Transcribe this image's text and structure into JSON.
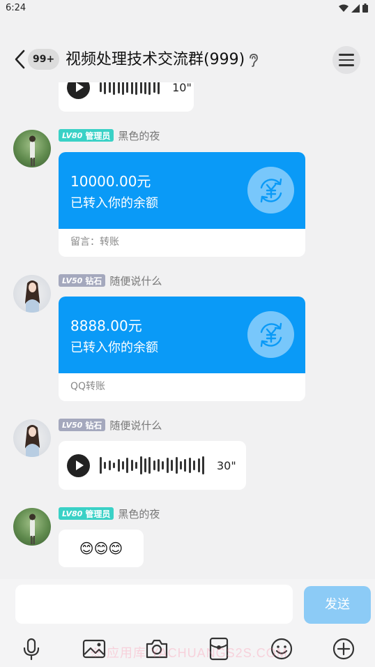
{
  "status_bar": {
    "time": "6:24"
  },
  "header": {
    "unread_badge": "99+",
    "title": "视频处理技术交流群(999)"
  },
  "messages": [
    {
      "kind": "voice",
      "duration": "10\""
    },
    {
      "kind": "transfer",
      "level": "LV80",
      "role": "管理员",
      "nickname": "黑色的夜",
      "amount": "10000.00元",
      "subtitle": "已转入你的余额",
      "note": "留言：转账"
    },
    {
      "kind": "transfer",
      "level": "LV50",
      "role": "钻石",
      "nickname": "随便说什么",
      "amount": "8888.00元",
      "subtitle": "已转入你的余额",
      "note": "QQ转账"
    },
    {
      "kind": "voice",
      "level": "LV50",
      "role": "钻石",
      "nickname": "随便说什么",
      "duration": "30\""
    },
    {
      "kind": "emoji",
      "level": "LV80",
      "role": "管理员",
      "nickname": "黑色的夜",
      "emojis": "😊😊😊"
    }
  ],
  "input": {
    "send_label": "发送"
  },
  "watermark": "※ 应用库 YACHUANGS2S.COM",
  "colors": {
    "transfer_blue": "#0a9af7",
    "admin_badge": "#3ad1c6",
    "diamond_badge": "#a4a8bd",
    "send_disabled": "#8ccbf6"
  },
  "icons": [
    "back-icon",
    "ear-icon",
    "menu-icon",
    "play-icon",
    "yuan-transfer-icon",
    "mic-icon",
    "image-icon",
    "camera-icon",
    "red-packet-icon",
    "emoji-icon",
    "plus-icon"
  ]
}
